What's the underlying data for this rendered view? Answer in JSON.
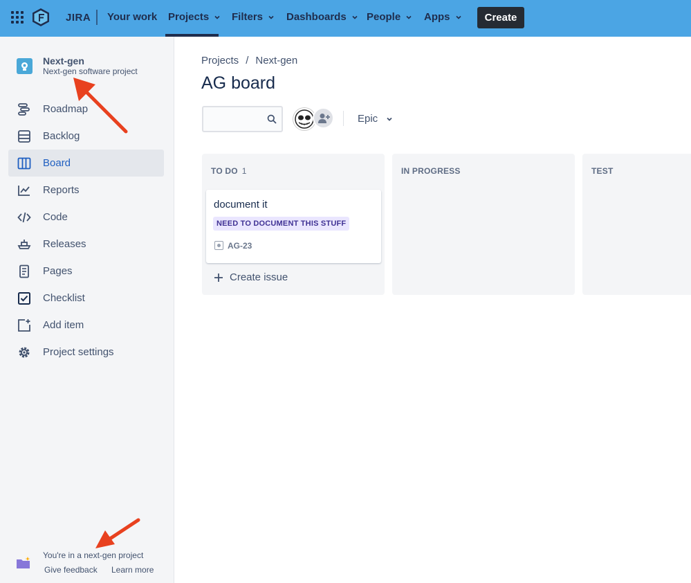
{
  "topnav": {
    "brand": "JIRA",
    "items": [
      {
        "label": "Your work",
        "has_chevron": false
      },
      {
        "label": "Projects",
        "has_chevron": true,
        "active": true
      },
      {
        "label": "Filters",
        "has_chevron": true
      },
      {
        "label": "Dashboards",
        "has_chevron": true
      },
      {
        "label": "People",
        "has_chevron": true
      },
      {
        "label": "Apps",
        "has_chevron": true
      }
    ],
    "create_label": "Create",
    "bg_color": "#4ba5e4"
  },
  "sidebar": {
    "project_name": "Next-gen",
    "project_type": "Next-gen software project",
    "items": [
      {
        "label": "Roadmap",
        "icon": "roadmap-icon"
      },
      {
        "label": "Backlog",
        "icon": "backlog-icon"
      },
      {
        "label": "Board",
        "icon": "board-icon",
        "active": true
      },
      {
        "label": "Reports",
        "icon": "reports-icon"
      },
      {
        "label": "Code",
        "icon": "code-icon"
      },
      {
        "label": "Releases",
        "icon": "releases-icon"
      },
      {
        "label": "Pages",
        "icon": "pages-icon"
      },
      {
        "label": "Checklist",
        "icon": "checklist-icon"
      },
      {
        "label": "Add item",
        "icon": "add-item-icon"
      },
      {
        "label": "Project settings",
        "icon": "gear-icon"
      }
    ],
    "footer": {
      "message": "You're in a next-gen project",
      "feedback_label": "Give feedback",
      "learn_more_label": "Learn more"
    }
  },
  "main": {
    "breadcrumb": [
      "Projects",
      "Next-gen"
    ],
    "breadcrumb_sep": "/",
    "title": "AG board",
    "epic_filter_label": "Epic",
    "columns": [
      {
        "name": "TO DO",
        "count": "1"
      },
      {
        "name": "IN PROGRESS",
        "count": ""
      },
      {
        "name": "TEST",
        "count": ""
      }
    ],
    "card": {
      "title": "document it",
      "label": "NEED TO DOCUMENT THIS STUFF",
      "key": "AG-23"
    },
    "create_issue_label": "Create issue"
  },
  "colors": {
    "accent": "#1f5fc1",
    "annotation_arrow": "#e8411f",
    "epic_label_bg": "#eae6ff",
    "epic_label_text": "#403294"
  }
}
